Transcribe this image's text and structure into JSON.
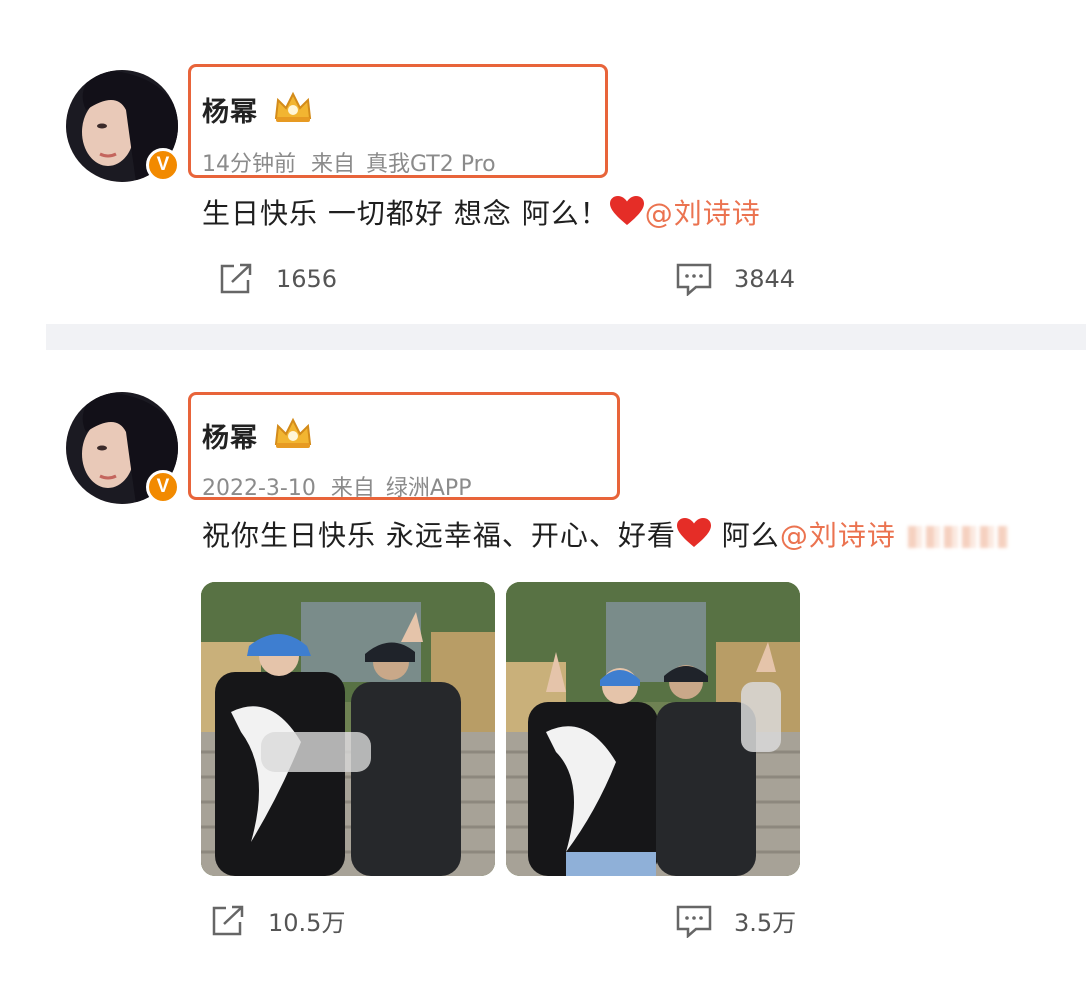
{
  "posts": [
    {
      "author": "杨幂",
      "verified_badge": "V",
      "time": "14分钟前",
      "source_prefix": "来自",
      "source": "真我GT2 Pro",
      "text": "生日快乐 一切都好 想念 阿么！",
      "mention": "@刘诗诗",
      "reposts": "1656",
      "comments": "3844"
    },
    {
      "author": "杨幂",
      "verified_badge": "V",
      "time": "2022-3-10",
      "source_prefix": "来自",
      "source": "绿洲APP",
      "text_before_heart": "祝你生日快乐 永远幸福、开心、好看",
      "text_after_heart": " 阿么",
      "mention": "@刘诗诗",
      "reposts": "10.5万",
      "comments": "3.5万"
    }
  ],
  "colors": {
    "highlight_box": "#e8643a",
    "mention": "#eb7350",
    "verified": "#f28a00",
    "meta_text": "#8b8b8b",
    "divider": "#f1f2f5"
  },
  "icons": [
    "repost-icon",
    "comment-icon",
    "heart-emoji",
    "crown-icon",
    "verified-badge"
  ]
}
